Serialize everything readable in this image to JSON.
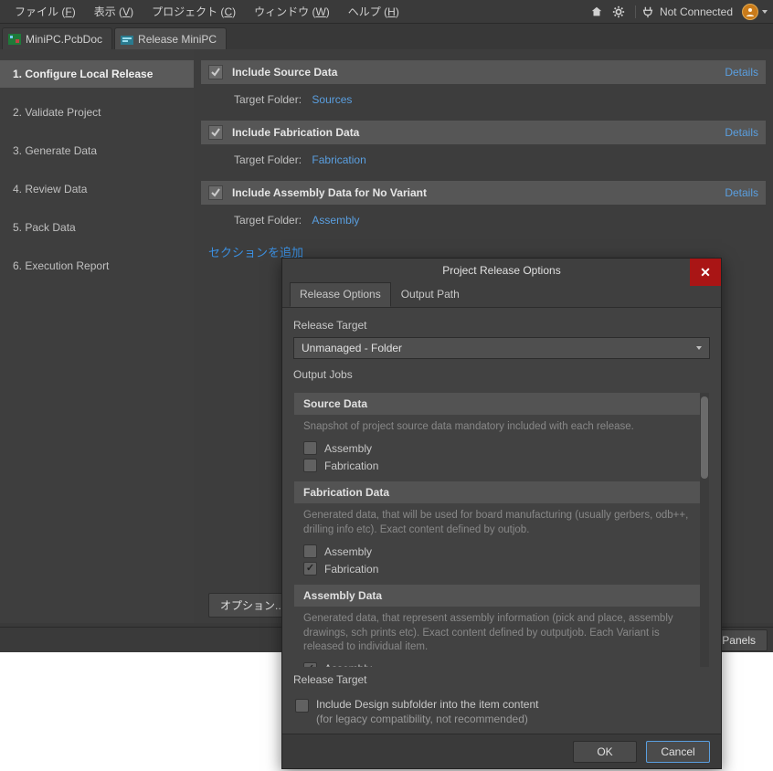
{
  "menubar": {
    "file": "ファイル",
    "file_m": "F",
    "view": "表示",
    "view_m": "V",
    "project": "プロジェクト",
    "project_m": "C",
    "window": "ウィンドウ",
    "window_m": "W",
    "help": "ヘルプ",
    "help_m": "H",
    "not_connected": "Not Connected"
  },
  "tabs": {
    "t0": "MiniPC.PcbDoc",
    "t1": "Release MiniPC"
  },
  "steps": {
    "s1": "1. Configure Local Release",
    "s2": "2. Validate Project",
    "s3": "3. Generate Data",
    "s4": "4. Review Data",
    "s5": "5. Pack Data",
    "s6": "6. Execution Report"
  },
  "sections": {
    "source_title": "Include Source Data",
    "fab_title": "Include Fabrication Data",
    "asm_title": "Include Assembly Data for No Variant",
    "details": "Details",
    "target_folder_label": "Target Folder:",
    "source_target": "Sources",
    "fab_target": "Fabrication",
    "asm_target": "Assembly",
    "add_section": "セクションを追加"
  },
  "bottom": {
    "options": "オプション...",
    "panels": "Panels"
  },
  "dialog": {
    "title": "Project Release Options",
    "tab_release": "Release Options",
    "tab_output": "Output Path",
    "release_target_label": "Release Target",
    "release_target_value": "Unmanaged - Folder",
    "output_jobs_label": "Output Jobs",
    "source_header": "Source Data",
    "source_desc": "Snapshot of project source data mandatory included with each release.",
    "fab_header": "Fabrication Data",
    "fab_desc": "Generated data, that will be used for board manufacturing (usually gerbers, odb++, drilling info etc). Exact content defined by outjob.",
    "asm_header": "Assembly Data",
    "asm_desc": "Generated data, that represent assembly information (pick and place, assembly drawings, sch prints etc). Exact content defined by outputjob. Each Variant is released to individual item.",
    "chk_assembly": "Assembly",
    "chk_fabrication": "Fabrication",
    "release_target_label2": "Release Target",
    "legacy_line1": "Include Design subfolder into the item content",
    "legacy_line2": "(for legacy compatibility, not recommended)",
    "ok": "OK",
    "cancel": "Cancel"
  }
}
